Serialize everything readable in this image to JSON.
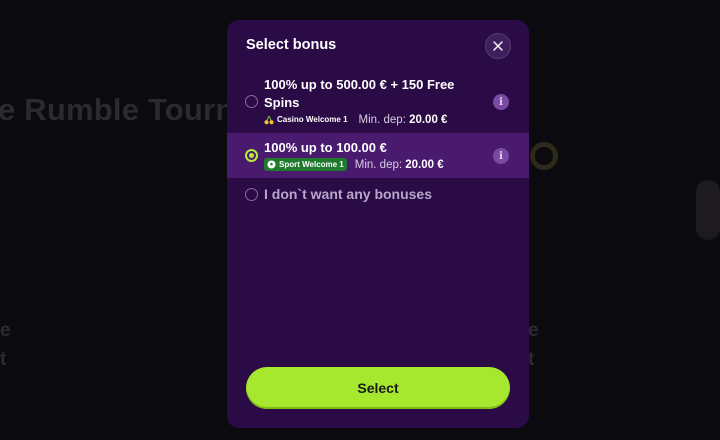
{
  "background": {
    "title_fragment": "e Rumble Tourn",
    "left_fragments": [
      "e",
      "t"
    ],
    "right_fragments": [
      "e",
      "t"
    ]
  },
  "modal": {
    "title": "Select bonus",
    "close_icon": "close-icon",
    "options": [
      {
        "title": "100% up to 500.00 € + 150 Free Spins",
        "badge_icon": "cherries-icon",
        "badge": "Casino Welcome 1",
        "min_dep_label": "Min. dep:",
        "min_dep_value": "20.00 €",
        "selected": false
      },
      {
        "title": "100% up to 100.00 €",
        "badge_icon": "soccer-ball-icon",
        "badge": "Sport Welcome 1",
        "min_dep_label": "Min. dep:",
        "min_dep_value": "20.00 €",
        "selected": true
      },
      {
        "title": "I don`t want any bonuses",
        "selected": false
      }
    ],
    "info_icon_glyph": "i",
    "select_label": "Select"
  },
  "colors": {
    "modal_bg": "#2a0b45",
    "selected_row": "#4a1a6e",
    "accent_green": "#a6e82e",
    "info_icon": "#7a4aa3"
  }
}
